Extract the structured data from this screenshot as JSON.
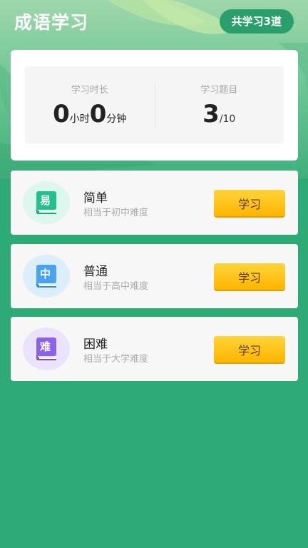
{
  "header": {
    "title": "成语学习",
    "total_badge": "共学习3道"
  },
  "stats": {
    "time_label": "学习时长",
    "hours_value": "0",
    "hours_unit": "小时",
    "minutes_value": "0",
    "minutes_unit": "分钟",
    "questions_label": "学习题目",
    "questions_done": "3",
    "questions_total": "/10"
  },
  "levels": [
    {
      "icon_char": "易",
      "name": "简单",
      "desc": "相当于初中难度",
      "button": "学习",
      "color": "#22c08a",
      "bg": "#ddf6ee"
    },
    {
      "icon_char": "中",
      "name": "普通",
      "desc": "相当于高中难度",
      "button": "学习",
      "color": "#4aa3f0",
      "bg": "#ddeefb"
    },
    {
      "icon_char": "难",
      "name": "困难",
      "desc": "相当于大学难度",
      "button": "学习",
      "color": "#8b62e8",
      "bg": "#ebe3fb"
    }
  ],
  "colors": {
    "background": "#2eaa76",
    "accent": "#ffc21a"
  }
}
